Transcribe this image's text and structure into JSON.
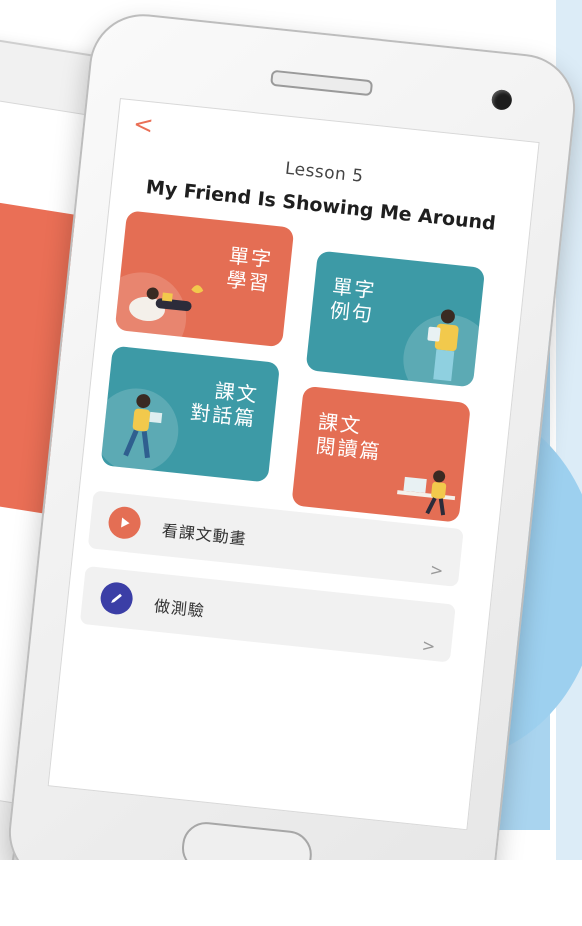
{
  "screen": {
    "back_label": "<",
    "lesson_label": "Lesson 5",
    "title": "My Friend Is Showing Me Around"
  },
  "cards": [
    {
      "line1": "單字",
      "line2": "學習",
      "color": "#e46e54"
    },
    {
      "line1": "單字",
      "line2": "例句",
      "color": "#3d9aa6"
    },
    {
      "line1": "課文",
      "line2": "對話篇",
      "color": "#3d9aa6"
    },
    {
      "line1": "課文",
      "line2": "閱讀篇",
      "color": "#e46e54"
    }
  ],
  "list": [
    {
      "label": "看課文動畫",
      "icon": "play-icon",
      "icon_color": "#e46e54",
      "chevron": ">"
    },
    {
      "label": "做測驗",
      "icon": "pencil-icon",
      "icon_color": "#3b3ea6",
      "chevron": ">"
    }
  ],
  "colors": {
    "accent_orange": "#e46e54",
    "accent_teal": "#3d9aa6",
    "accent_indigo": "#3b3ea6",
    "background_blue": "#a9d4ef"
  }
}
